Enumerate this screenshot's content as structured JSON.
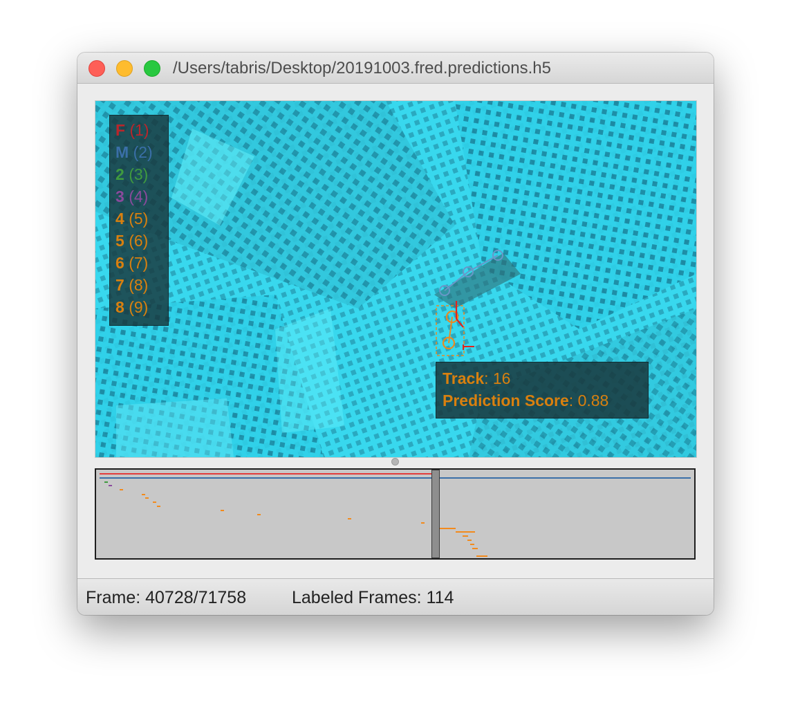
{
  "window": {
    "title": "/Users/tabris/Desktop/20191003.fred.predictions.h5"
  },
  "legend": {
    "items": [
      {
        "name": "F",
        "num": "(1)",
        "color": "#b9262b"
      },
      {
        "name": "M",
        "num": "(2)",
        "color": "#3a6fa8"
      },
      {
        "name": "2",
        "num": "(3)",
        "color": "#3f9a3f"
      },
      {
        "name": "3",
        "num": "(4)",
        "color": "#8a4a9c"
      },
      {
        "name": "4",
        "num": "(5)",
        "color": "#d9800f"
      },
      {
        "name": "5",
        "num": "(6)",
        "color": "#d9800f"
      },
      {
        "name": "6",
        "num": "(7)",
        "color": "#d9800f"
      },
      {
        "name": "7",
        "num": "(8)",
        "color": "#d9800f"
      },
      {
        "name": "8",
        "num": "(9)",
        "color": "#d9800f"
      }
    ]
  },
  "instance_info": {
    "track_label": "Track",
    "track_value": "16",
    "score_label": "Prediction Score",
    "score_value": "0.88"
  },
  "status": {
    "frame": "Frame: 40728/71758",
    "labeled": "Labeled Frames: 114"
  },
  "timeline": {
    "track_colors": [
      "#e23c3c",
      "#3a6fa8",
      "#3f9a3f",
      "#8a4a9c",
      "#f28a1c"
    ]
  }
}
